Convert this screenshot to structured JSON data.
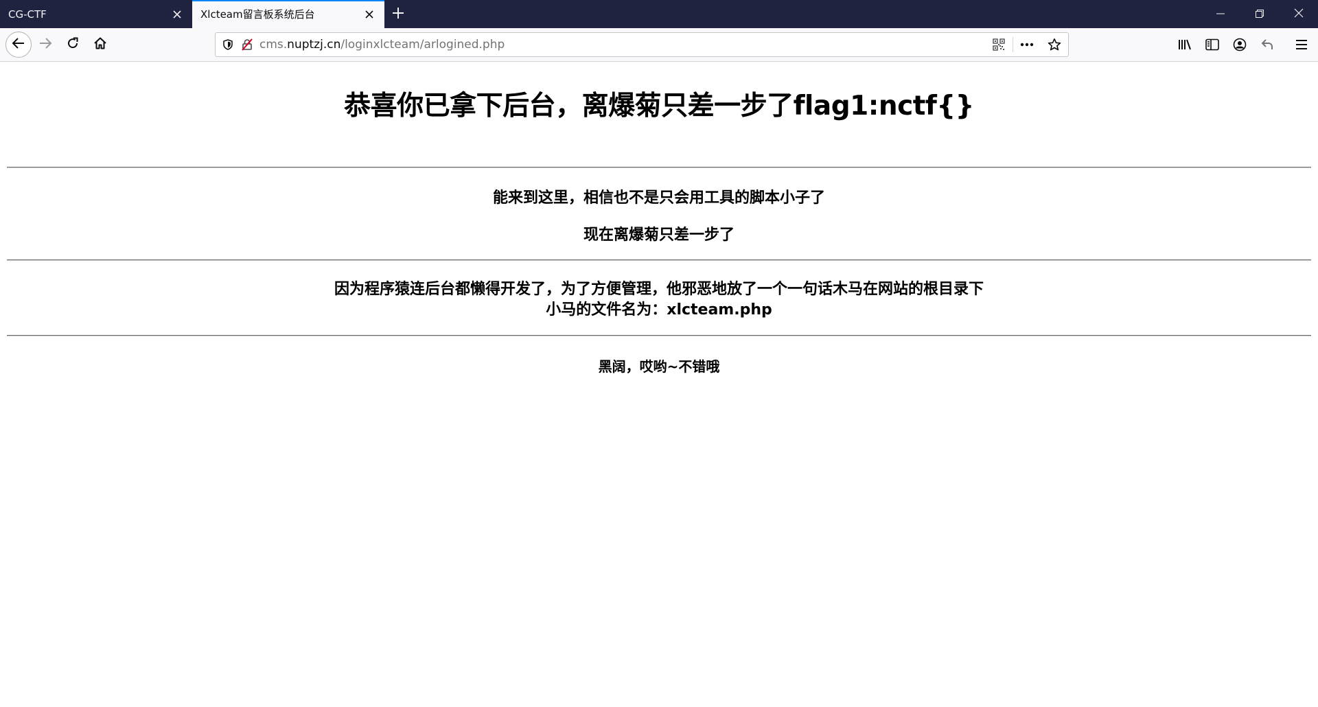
{
  "browser": {
    "tabs": [
      {
        "title": "CG-CTF",
        "active": false
      },
      {
        "title": "Xlcteam留言板系统后台",
        "active": true
      }
    ],
    "url": {
      "prefix": "cms.",
      "host": "nuptzj.cn",
      "path": "/loginxlcteam/arlogined.php"
    },
    "icons": {
      "tab_close": "close-icon",
      "new_tab": "plus-icon",
      "minimize": "minimize-icon",
      "restore": "restore-icon",
      "close_window": "close-window-icon",
      "back": "back-arrow-icon",
      "forward": "forward-arrow-icon",
      "reload": "reload-icon",
      "home": "home-icon",
      "tracking": "shield-icon",
      "connection": "insecure-connection-icon",
      "qr": "qr-code-icon",
      "page_actions": "more-icon",
      "bookmark": "star-icon",
      "library": "library-icon",
      "sidebar": "sidebar-icon",
      "account": "account-icon",
      "undo": "undo-icon",
      "menu": "hamburger-menu-icon"
    },
    "colors": {
      "tabbar": "#202340",
      "active_tab_accent": "#0a84ff",
      "insecure_icon": "#d70022"
    }
  },
  "page": {
    "heading": "恭喜你已拿下后台，离爆菊只差一步了flag1:nctf{}",
    "line1": "能来到这里，相信也不是只会用工具的脚本小子了",
    "line2": "现在离爆菊只差一步了",
    "line3": "因为程序猿连后台都懒得开发了，为了方便管理，他邪恶地放了一个一句话木马在网站的根目录下",
    "line4": "小马的文件名为：xlcteam.php",
    "line5": "黑阔，哎哟~不错哦"
  }
}
